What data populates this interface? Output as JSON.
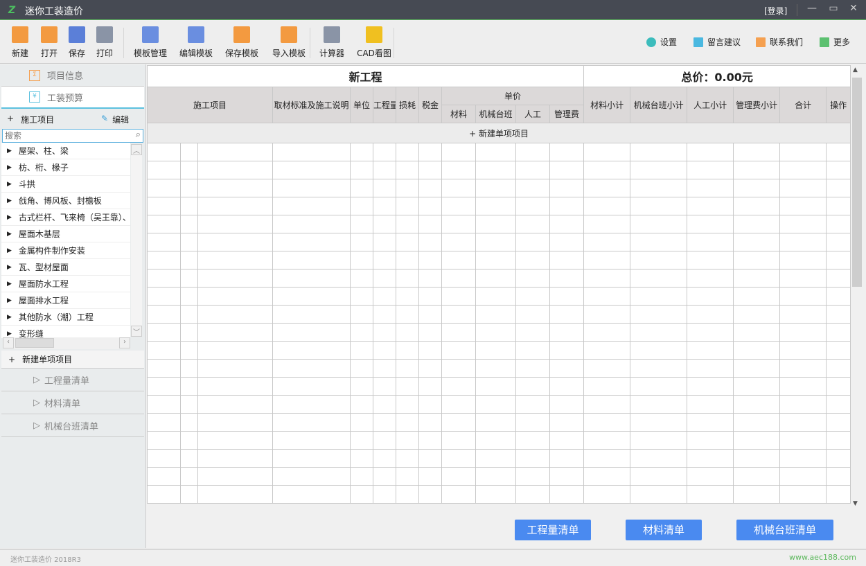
{
  "app": {
    "title": "迷你工装造价",
    "login": "[登录]"
  },
  "toolbar": {
    "items": [
      {
        "label": "新建",
        "icon": "new-file-icon",
        "color": "#f39a40"
      },
      {
        "label": "打开",
        "icon": "open-folder-icon",
        "color": "#f39a40"
      },
      {
        "label": "保存",
        "icon": "save-icon",
        "color": "#5b7fd8"
      },
      {
        "label": "打印",
        "icon": "print-icon",
        "color": "#8a94a6"
      },
      {
        "label": "模板管理",
        "icon": "template-manage-icon",
        "color": "#6a8ee0"
      },
      {
        "label": "编辑模板",
        "icon": "edit-template-icon",
        "color": "#6a8ee0"
      },
      {
        "label": "保存模板",
        "icon": "save-template-icon",
        "color": "#f39a40"
      },
      {
        "label": "导入模板",
        "icon": "import-template-icon",
        "color": "#f39a40"
      },
      {
        "label": "计算器",
        "icon": "calculator-icon",
        "color": "#8a94a6"
      },
      {
        "label": "CAD看图",
        "icon": "dwg-icon",
        "color": "#f0c020"
      }
    ],
    "right": [
      {
        "label": "设置",
        "icon": "gear-icon",
        "color": "#3cbcbc"
      },
      {
        "label": "留言建议",
        "icon": "note-icon",
        "color": "#4ab8e0"
      },
      {
        "label": "联系我们",
        "icon": "mail-icon",
        "color": "#f5a050"
      },
      {
        "label": "更多",
        "icon": "more-icon",
        "color": "#5cc070"
      }
    ]
  },
  "sidebar": {
    "tabs": [
      {
        "label": "项目信息"
      },
      {
        "label": "工装预算"
      }
    ],
    "section_label": "施工项目",
    "edit_label": "编辑",
    "search_placeholder": "搜索",
    "tree": [
      "屋架、柱、梁",
      "枋、桁、椽子",
      "斗拱",
      "戗角、博风板、封檐板",
      "古式栏杆、飞来椅（吴王靠）、",
      "屋面木基层",
      "金属构件制作安装",
      "瓦、型材屋面",
      "屋面防水工程",
      "屋面排水工程",
      "其他防水（潮）工程",
      "变形缝"
    ],
    "new_item": "新建单项项目",
    "lists": [
      "工程量清单",
      "材料清单",
      "机械台班清单"
    ]
  },
  "table": {
    "title": "新工程",
    "total": "总价：0.00元",
    "headers": {
      "project": "施工项目",
      "spec": "取材标准及施工说明",
      "unit": "单位",
      "qty": "工程量",
      "loss": "损耗",
      "tax": "税金",
      "unit_price": "单价",
      "material": "材料",
      "machine": "机械台班",
      "labor": "人工",
      "mgmt": "管理费",
      "material_sub": "材料小计",
      "machine_sub": "机械台班小计",
      "labor_sub": "人工小计",
      "mgmt_sub": "管理费小计",
      "total": "合计",
      "action": "操作"
    },
    "new_row": "+ 新建单项项目"
  },
  "buttons": [
    "工程量清单",
    "材料清单",
    "机械台班清单"
  ],
  "status": {
    "version": "迷你工装造价 2018R3",
    "website": "www.aec188.com"
  }
}
